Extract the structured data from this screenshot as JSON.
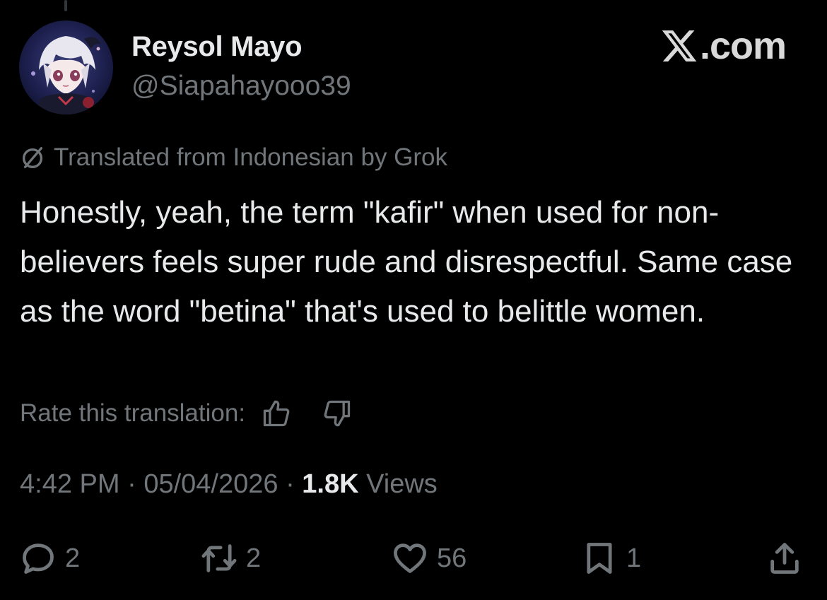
{
  "author": {
    "display_name": "Reysol Mayo",
    "handle": "@Siapahayooo39"
  },
  "site": {
    "logo_text": ".com",
    "logo_icon": "x-logo-icon"
  },
  "translation": {
    "notice": "Translated from Indonesian by Grok",
    "icon": "grok-icon"
  },
  "tweet": {
    "text": "Honestly, yeah, the term \"kafir\" when used for non-believers feels super rude and disrespectful. Same case as the word \"betina\" that's used to belittle women."
  },
  "rate": {
    "label": "Rate this translation:",
    "up_icon": "thumbs-up-icon",
    "down_icon": "thumbs-down-icon"
  },
  "meta": {
    "time": "4:42 PM",
    "separator": "·",
    "date": "05/04/2026",
    "views_count": "1.8K",
    "views_label": "Views"
  },
  "actions": {
    "reply_count": "2",
    "repost_count": "2",
    "like_count": "56",
    "bookmark_count": "1"
  },
  "colors": {
    "background": "#000000",
    "primary_text": "#e7e9ea",
    "secondary_text": "#71767b"
  }
}
